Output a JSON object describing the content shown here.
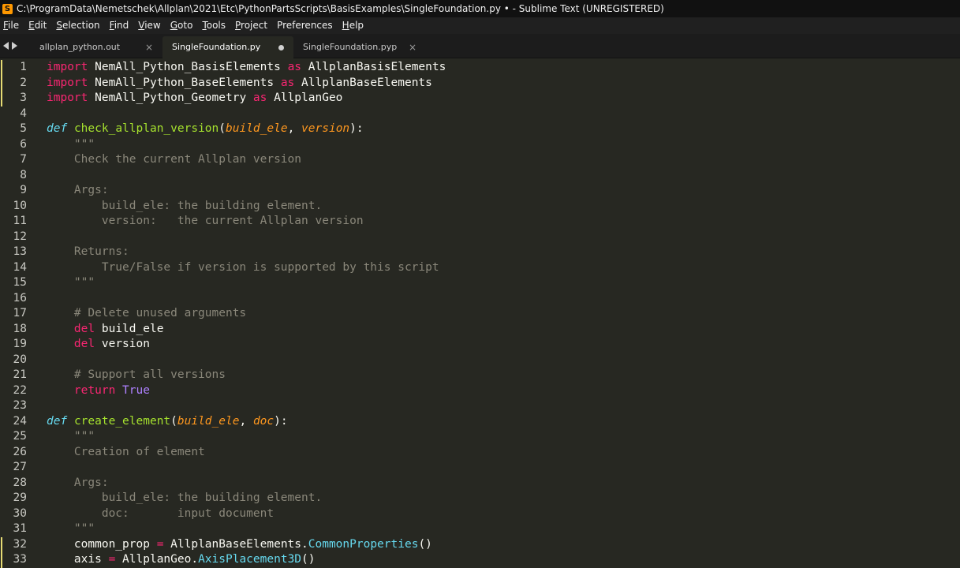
{
  "window": {
    "title": "C:\\ProgramData\\Nemetschek\\Allplan\\2021\\Etc\\PythonPartsScripts\\BasisExamples\\SingleFoundation.py • - Sublime Text (UNREGISTERED)",
    "app_icon_glyph": "S",
    "accent_color": "#ff9800"
  },
  "menu": [
    {
      "label": "File",
      "u": "F",
      "rest": "ile"
    },
    {
      "label": "Edit",
      "u": "E",
      "rest": "dit"
    },
    {
      "label": "Selection",
      "u": "S",
      "rest": "election"
    },
    {
      "label": "Find",
      "u": "F",
      "rest": "ind",
      "u_pos": 0
    },
    {
      "label": "View",
      "u": "V",
      "rest": "iew"
    },
    {
      "label": "Goto",
      "u": "G",
      "rest": "oto"
    },
    {
      "label": "Tools",
      "u": "T",
      "rest": "ools"
    },
    {
      "label": "Project",
      "u": "P",
      "rest": "roject"
    },
    {
      "label": "Preferences",
      "u": "",
      "rest": "Preferences"
    },
    {
      "label": "Help",
      "u": "H",
      "rest": "elp"
    }
  ],
  "tabs": [
    {
      "label": "allplan_python.out",
      "active": false,
      "modified": false
    },
    {
      "label": "SingleFoundation.py",
      "active": true,
      "modified": true
    },
    {
      "label": "SingleFoundation.pyp",
      "active": false,
      "modified": false
    }
  ],
  "tab_close_glyph": "×",
  "code_lines": [
    {
      "n": "1",
      "m": true,
      "t": [
        [
          "import",
          "kw"
        ],
        [
          " NemAll_Python_BasisElements ",
          "plain"
        ],
        [
          "as",
          "kw"
        ],
        [
          " AllplanBasisElements",
          "plain"
        ]
      ]
    },
    {
      "n": "2",
      "m": true,
      "t": [
        [
          "import",
          "kw"
        ],
        [
          " NemAll_Python_BaseElements ",
          "plain"
        ],
        [
          "as",
          "kw"
        ],
        [
          " AllplanBaseElements",
          "plain"
        ]
      ]
    },
    {
      "n": "3",
      "m": true,
      "t": [
        [
          "import",
          "kw"
        ],
        [
          " NemAll_Python_Geometry ",
          "plain"
        ],
        [
          "as",
          "kw"
        ],
        [
          " AllplanGeo",
          "plain"
        ]
      ]
    },
    {
      "n": "4",
      "m": false,
      "t": []
    },
    {
      "n": "5",
      "m": false,
      "t": [
        [
          "def",
          "def"
        ],
        [
          " ",
          "plain"
        ],
        [
          "check_allplan_version",
          "fn"
        ],
        [
          "(",
          "plain"
        ],
        [
          "build_ele",
          "param"
        ],
        [
          ", ",
          "plain"
        ],
        [
          "version",
          "param"
        ],
        [
          "):",
          "plain"
        ]
      ]
    },
    {
      "n": "6",
      "m": false,
      "t": [
        [
          "    \"\"\"",
          "doc"
        ]
      ]
    },
    {
      "n": "7",
      "m": false,
      "t": [
        [
          "    Check the current Allplan version",
          "doc"
        ]
      ]
    },
    {
      "n": "8",
      "m": false,
      "t": []
    },
    {
      "n": "9",
      "m": false,
      "t": [
        [
          "    Args:",
          "doc"
        ]
      ]
    },
    {
      "n": "10",
      "m": false,
      "t": [
        [
          "        build_ele: the building element.",
          "doc"
        ]
      ]
    },
    {
      "n": "11",
      "m": false,
      "t": [
        [
          "        version:   the current Allplan version",
          "doc"
        ]
      ]
    },
    {
      "n": "12",
      "m": false,
      "t": []
    },
    {
      "n": "13",
      "m": false,
      "t": [
        [
          "    Returns:",
          "doc"
        ]
      ]
    },
    {
      "n": "14",
      "m": false,
      "t": [
        [
          "        True/False if version is supported by this script",
          "doc"
        ]
      ]
    },
    {
      "n": "15",
      "m": false,
      "t": [
        [
          "    \"\"\"",
          "doc"
        ]
      ]
    },
    {
      "n": "16",
      "m": false,
      "t": []
    },
    {
      "n": "17",
      "m": false,
      "t": [
        [
          "    # Delete unused arguments",
          "comment"
        ]
      ]
    },
    {
      "n": "18",
      "m": false,
      "t": [
        [
          "    ",
          "plain"
        ],
        [
          "del",
          "kw"
        ],
        [
          " build_ele",
          "plain"
        ]
      ]
    },
    {
      "n": "19",
      "m": false,
      "t": [
        [
          "    ",
          "plain"
        ],
        [
          "del",
          "kw"
        ],
        [
          " version",
          "plain"
        ]
      ]
    },
    {
      "n": "20",
      "m": false,
      "t": []
    },
    {
      "n": "21",
      "m": false,
      "t": [
        [
          "    # Support all versions",
          "comment"
        ]
      ]
    },
    {
      "n": "22",
      "m": false,
      "t": [
        [
          "    ",
          "plain"
        ],
        [
          "return",
          "kw"
        ],
        [
          " ",
          "plain"
        ],
        [
          "True",
          "const"
        ]
      ]
    },
    {
      "n": "23",
      "m": false,
      "t": []
    },
    {
      "n": "24",
      "m": false,
      "t": [
        [
          "def",
          "def"
        ],
        [
          " ",
          "plain"
        ],
        [
          "create_element",
          "fn"
        ],
        [
          "(",
          "plain"
        ],
        [
          "build_ele",
          "param"
        ],
        [
          ", ",
          "plain"
        ],
        [
          "doc",
          "param"
        ],
        [
          "):",
          "plain"
        ]
      ]
    },
    {
      "n": "25",
      "m": false,
      "t": [
        [
          "    \"\"\"",
          "doc"
        ]
      ]
    },
    {
      "n": "26",
      "m": false,
      "t": [
        [
          "    Creation of element",
          "doc"
        ]
      ]
    },
    {
      "n": "27",
      "m": false,
      "t": []
    },
    {
      "n": "28",
      "m": false,
      "t": [
        [
          "    Args:",
          "doc"
        ]
      ]
    },
    {
      "n": "29",
      "m": false,
      "t": [
        [
          "        build_ele: the building element.",
          "doc"
        ]
      ]
    },
    {
      "n": "30",
      "m": false,
      "t": [
        [
          "        doc:       input document",
          "doc"
        ]
      ]
    },
    {
      "n": "31",
      "m": false,
      "t": [
        [
          "    \"\"\"",
          "doc"
        ]
      ]
    },
    {
      "n": "32",
      "m": true,
      "t": [
        [
          "    common_prop ",
          "plain"
        ],
        [
          "=",
          "op"
        ],
        [
          " AllplanBaseElements.",
          "plain"
        ],
        [
          "CommonProperties",
          "call"
        ],
        [
          "()",
          "plain"
        ]
      ]
    },
    {
      "n": "33",
      "m": true,
      "t": [
        [
          "    axis ",
          "plain"
        ],
        [
          "=",
          "op"
        ],
        [
          " AllplanGeo.",
          "plain"
        ],
        [
          "AxisPlacement3D",
          "call"
        ],
        [
          "()",
          "plain"
        ]
      ]
    }
  ]
}
